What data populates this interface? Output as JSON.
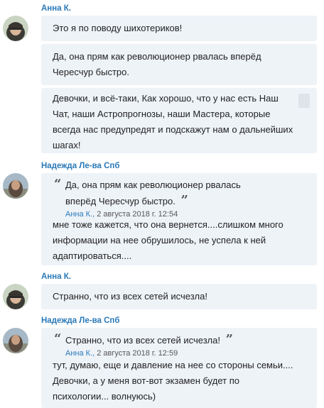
{
  "messages": [
    {
      "author": "Анна К.",
      "bubbles": [
        {
          "text": "Это я по поводу шихотериков!"
        },
        {
          "lines": [
            "Да, она прям как революционер рвалась вперёд",
            "Чересчур быстро."
          ]
        },
        {
          "lines": [
            "Девочки, и всё-таки, Как хорошо, что у нас есть Наш",
            "Чат, наши Астропрогнозы, наши Мастера, которые",
            "всегда нас предупредят и подскажут нам о дальнейших",
            "шагах!"
          ]
        }
      ]
    },
    {
      "author": "Надежда Ле-ва Спб",
      "quote": {
        "lines": [
          "Да, она прям как революционер рвалась",
          "вперёд Чересчур быстро."
        ],
        "author": "Анна К.,",
        "date": "2 августа 2018 г. 12:54"
      },
      "lines": [
        "мне тоже кажется, что она вернется....слишком много",
        "информации на нее обрушилось, не успела к ней",
        "адаптироваться...."
      ]
    },
    {
      "author": "Анна К.",
      "bubbles": [
        {
          "text": "Странно, что из всех сетей исчезла!"
        }
      ]
    },
    {
      "author": "Надежда Ле-ва Спб",
      "quote": {
        "text": "Странно, что из всех сетей исчезла!",
        "author": "Анна К.,",
        "date": "2 августа 2018 г. 12:59"
      },
      "lines": [
        "тут, думаю, еще и давление на нее со стороны семьи....",
        "Девочки, а у меня вот-вот экзамен будет по",
        "психологии... волнуюсь)"
      ]
    }
  ]
}
